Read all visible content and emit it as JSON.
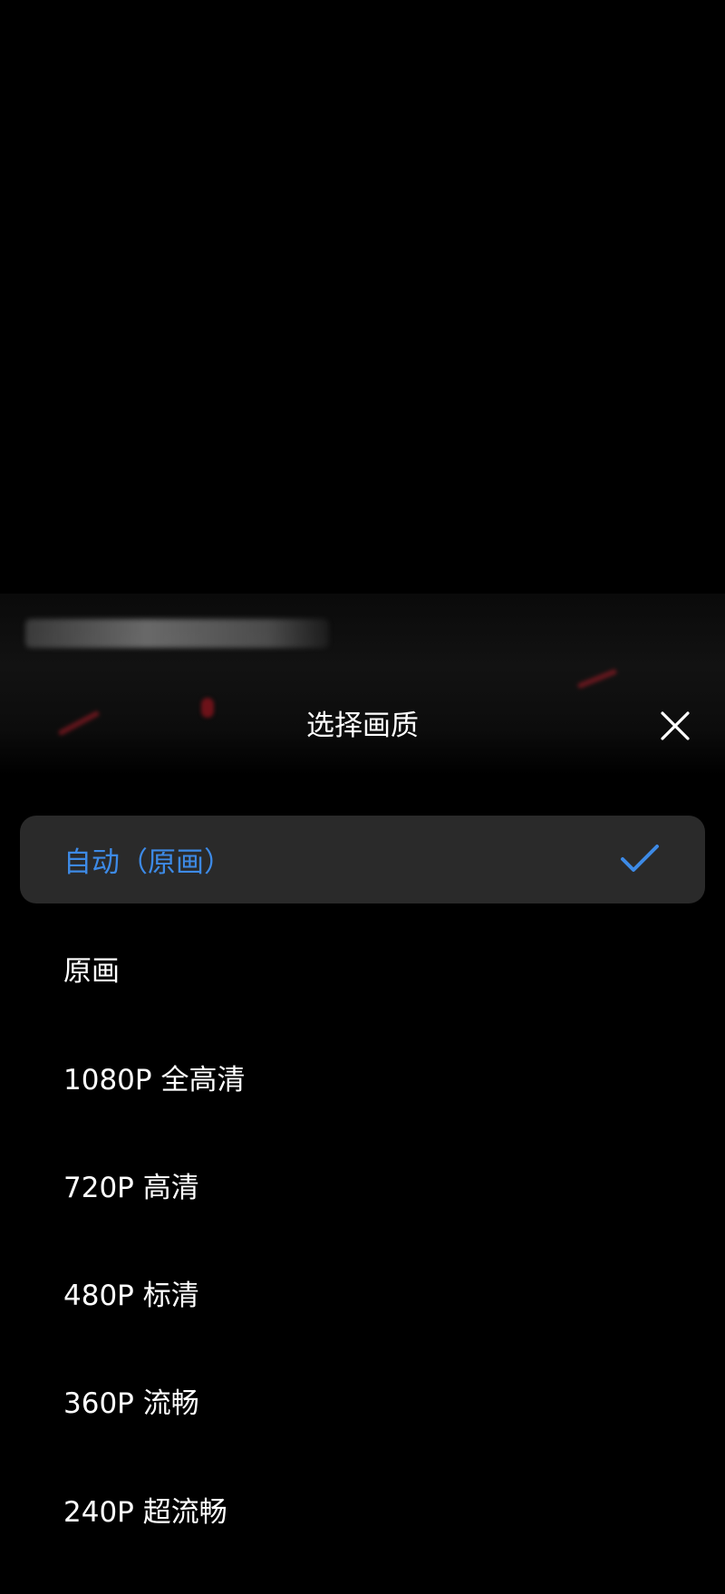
{
  "sheet": {
    "title": "选择画质",
    "close_icon": "close-icon",
    "check_icon": "check-icon",
    "accent_color": "#3d8ae6",
    "options": [
      {
        "label": "自动（原画）",
        "selected": true
      },
      {
        "label": "原画",
        "selected": false
      },
      {
        "label": "1080P 全高清",
        "selected": false
      },
      {
        "label": "720P 高清",
        "selected": false
      },
      {
        "label": "480P 标清",
        "selected": false
      },
      {
        "label": "360P 流畅",
        "selected": false
      },
      {
        "label": "240P 超流畅",
        "selected": false
      }
    ]
  }
}
